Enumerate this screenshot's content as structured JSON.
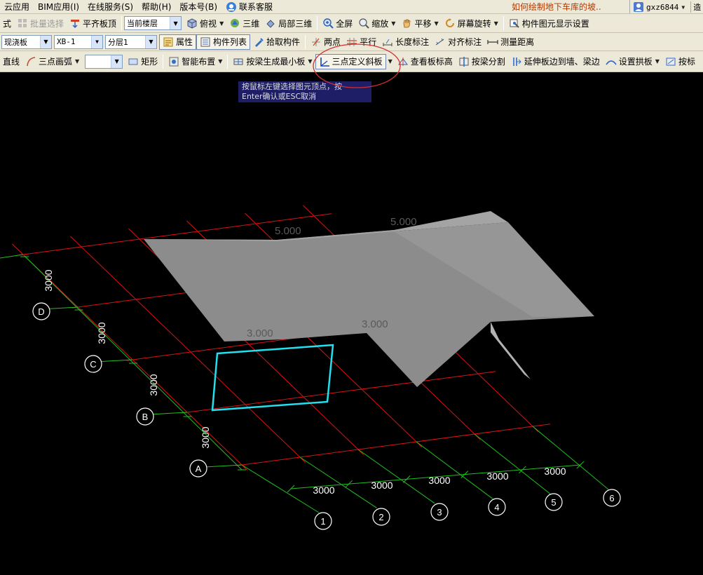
{
  "menu": {
    "items": [
      "云应用",
      "BIM应用(I)",
      "在线服务(S)",
      "帮助(H)",
      "版本号(B)"
    ],
    "service_label": "联系客服",
    "ticker": "如何绘制地下车库的坡..",
    "user": "gxz6844",
    "extra": "造"
  },
  "toolbar1": {
    "mode_label": "式",
    "batch_select": "批量选择",
    "align_top": "平齐板顶",
    "floor_combo": "当前楼层",
    "view_top": "俯视",
    "three_d": "三维",
    "local_3d": "局部三维",
    "fullscreen": "全屏",
    "zoom": "缩放",
    "pan": "平移",
    "rotate": "屏幕旋转",
    "display_settings": "构件图元显示设置"
  },
  "toolbar2": {
    "type_combo": "现浇板",
    "name_combo": "XB-1",
    "layer_combo": "分层1",
    "properties": "属性",
    "component_list": "构件列表",
    "pick_component": "拾取构件",
    "two_points": "两点",
    "parallel": "平行",
    "length_dim": "长度标注",
    "align_dim": "对齐标注",
    "measure": "测量距离"
  },
  "toolbar3": {
    "line": "直线",
    "arc3": "三点画弧",
    "color_combo": "",
    "rect": "矩形",
    "smart_layout": "智能布置",
    "beam_min_slab": "按梁生成最小板",
    "three_point_slope": "三点定义斜板",
    "view_slab_elev": "查看板标高",
    "split_by_beam": "按梁分割",
    "extend_slab": "延伸板边到墙、梁边",
    "set_arch": "设置拱板",
    "by_more": "按标"
  },
  "tooltip": {
    "line1": "按鼠标左键选择图元顶点，按",
    "line2": "Enter确认或ESC取消"
  },
  "drawing": {
    "elevations": [
      "5.000",
      "5.000",
      "3.000",
      "3.000"
    ],
    "row_axes": [
      "A",
      "B",
      "C",
      "D"
    ],
    "col_axes": [
      "1",
      "2",
      "3",
      "4",
      "5",
      "6"
    ],
    "row_spacings": [
      "3000",
      "3000",
      "3000",
      "3000"
    ],
    "col_spacings": [
      "3000",
      "3000",
      "3000",
      "3000",
      "3000"
    ],
    "colors": {
      "grid_red": "#e01010",
      "grid_green": "#20c020",
      "slab": "#8c8c8c",
      "selection": "#22e0f0",
      "annotation": "#ffffff",
      "highlight_circle": "#d03030"
    }
  }
}
